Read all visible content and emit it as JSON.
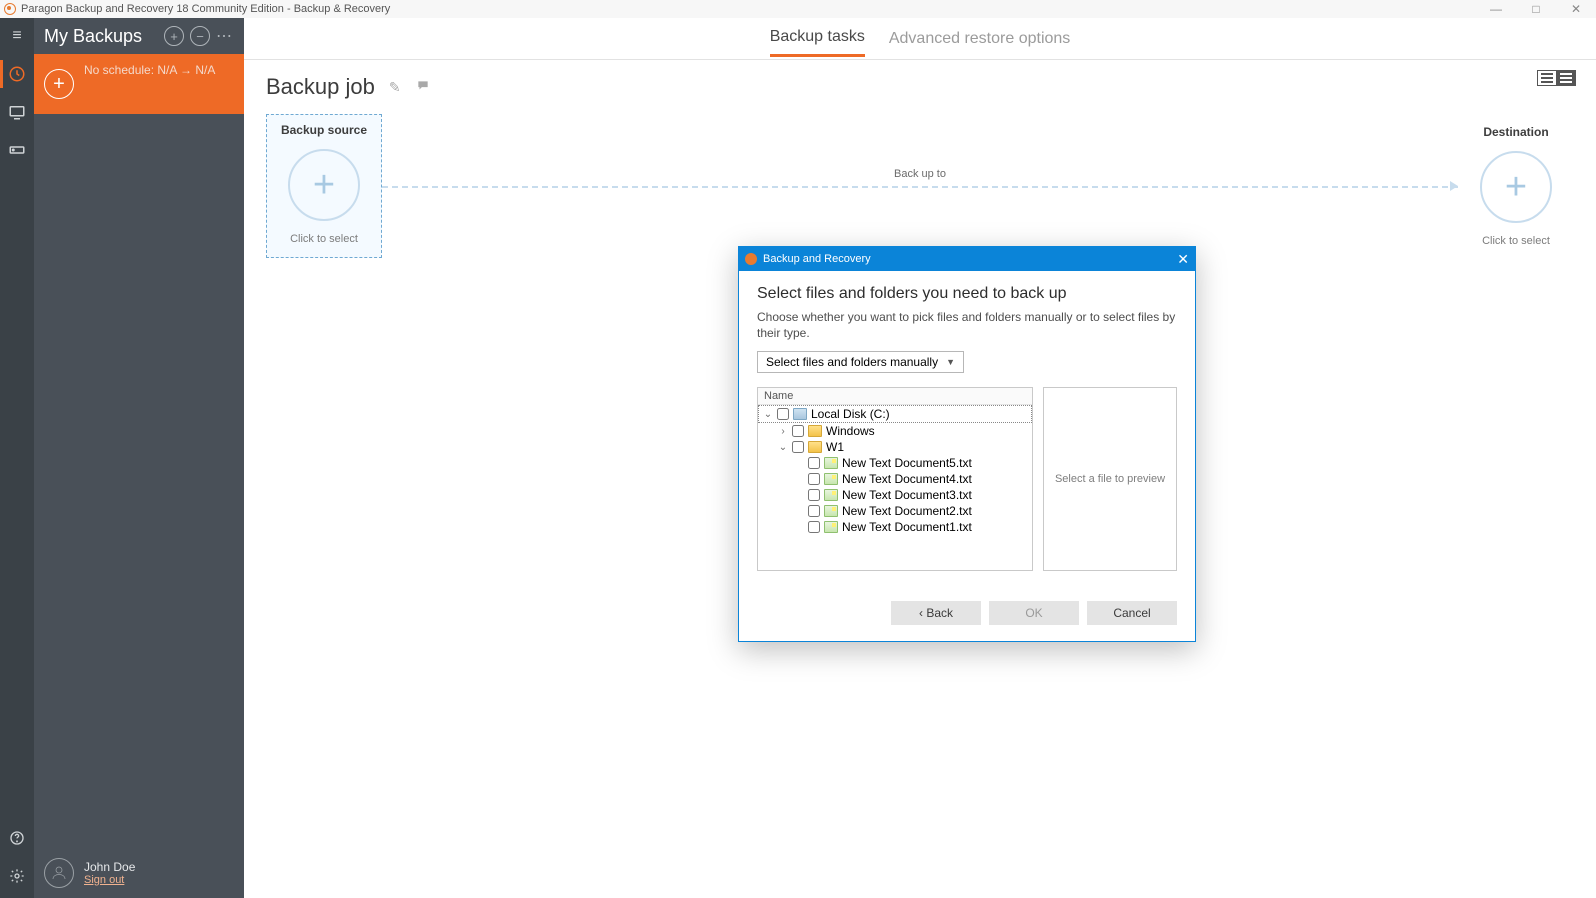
{
  "window": {
    "title": "Paragon Backup and Recovery 18 Community Edition - Backup & Recovery"
  },
  "sidebar": {
    "title": "My Backups",
    "schedule_text": "No schedule: N/A → N/A",
    "user_name": "John Doe",
    "sign_out": "Sign out"
  },
  "tabs": {
    "backup_tasks": "Backup tasks",
    "advanced_restore": "Advanced restore options"
  },
  "page": {
    "heading": "Backup job",
    "source_label": "Backup source",
    "source_sub": "Click to select",
    "dest_label": "Destination",
    "dest_sub": "Click to select",
    "connector_label": "Back up to"
  },
  "dialog": {
    "title": "Backup and Recovery",
    "heading": "Select files and folders you need to back up",
    "description": "Choose whether you want to pick files and folders manually or to select files by their type.",
    "combo_value": "Select files and folders manually",
    "col_name": "Name",
    "preview_placeholder": "Select a file to preview",
    "tree": {
      "root": "Local Disk (C:)",
      "child1": "Windows",
      "child2": "W1",
      "files": [
        "New Text Document5.txt",
        "New Text Document4.txt",
        "New Text Document3.txt",
        "New Text Document2.txt",
        "New Text Document1.txt"
      ]
    },
    "buttons": {
      "back": "‹ Back",
      "ok": "OK",
      "cancel": "Cancel"
    }
  }
}
